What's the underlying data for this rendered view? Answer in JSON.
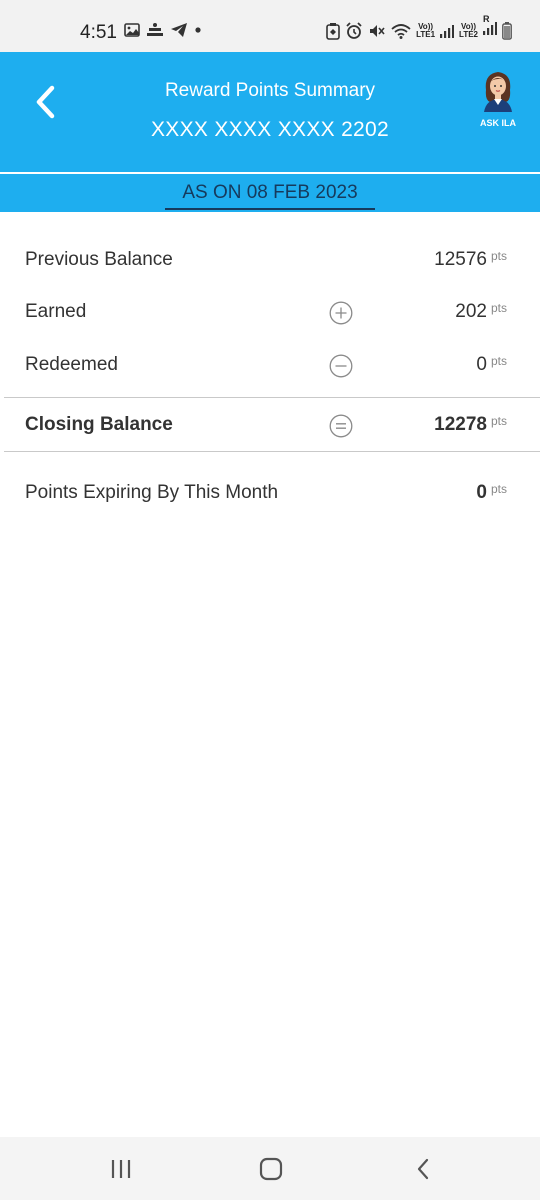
{
  "status_bar": {
    "time": "4:51",
    "net1_label_top": "Vo))",
    "net1_label_bottom": "LTE1",
    "net2_label_top": "Vo))",
    "net2_label_bottom": "LTE2",
    "roaming": "R"
  },
  "header": {
    "title": "Reward Points Summary",
    "card_number": "XXXX XXXX XXXX 2202",
    "assistant_label": "ASK ILA"
  },
  "date_strip": {
    "text": "AS ON 08 FEB 2023"
  },
  "summary": {
    "previous_balance": {
      "label": "Previous Balance",
      "value": "12576",
      "unit": "pts"
    },
    "earned": {
      "label": "Earned",
      "value": "202",
      "unit": "pts",
      "icon": "plus-circle-icon"
    },
    "redeemed": {
      "label": "Redeemed",
      "value": "0",
      "unit": "pts",
      "icon": "minus-circle-icon"
    },
    "closing_balance": {
      "label": "Closing Balance",
      "value": "12278",
      "unit": "pts",
      "icon": "equals-circle-icon"
    },
    "expiring": {
      "label": "Points Expiring By This Month",
      "value": "0",
      "unit": "pts"
    }
  },
  "colors": {
    "header_bg": "#1eaeef",
    "date_text": "#163a5c",
    "divider": "#c9c9c9"
  },
  "nav_bar": {
    "icons": [
      "recent-apps-icon",
      "home-icon",
      "back-icon"
    ]
  }
}
